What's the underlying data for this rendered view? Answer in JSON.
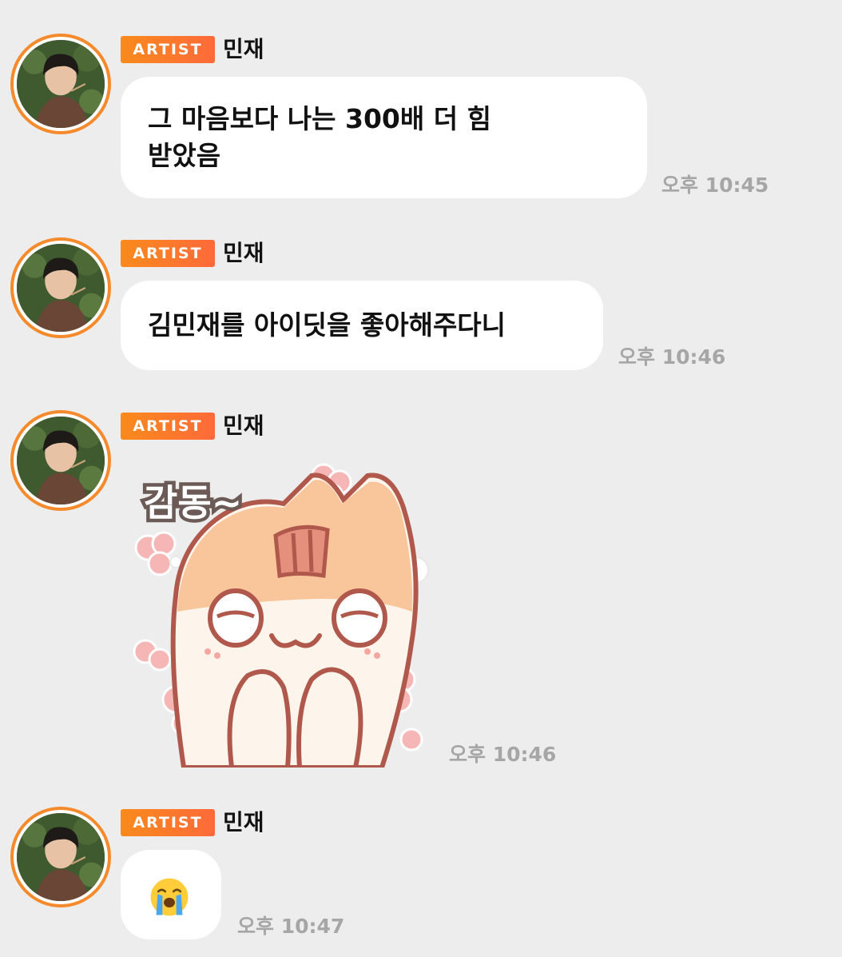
{
  "messages": [
    {
      "badge": "ARTIST",
      "sender": "민재",
      "text_lines": [
        "그 마음보다 나는 300배 더 힘",
        "받았음"
      ],
      "time": "오후 10:45"
    },
    {
      "badge": "ARTIST",
      "sender": "민재",
      "text": "김민재를 아이딧을 좋아해주다니",
      "time": "오후 10:46"
    },
    {
      "badge": "ARTIST",
      "sender": "민재",
      "sticker_text": "감동~",
      "sticker": "crying-cat-sticker",
      "time": "오후 10:46"
    },
    {
      "badge": "ARTIST",
      "sender": "민재",
      "emoji": "loudly-crying-face",
      "time": "오후 10:47"
    }
  ],
  "colors": {
    "background": "#ededed",
    "bubble": "#ffffff",
    "badge_gradient_start": "#fa8a1c",
    "badge_gradient_end": "#fd6a3a",
    "avatar_ring": "#f58a2c",
    "time_text": "#a6a6a6"
  }
}
